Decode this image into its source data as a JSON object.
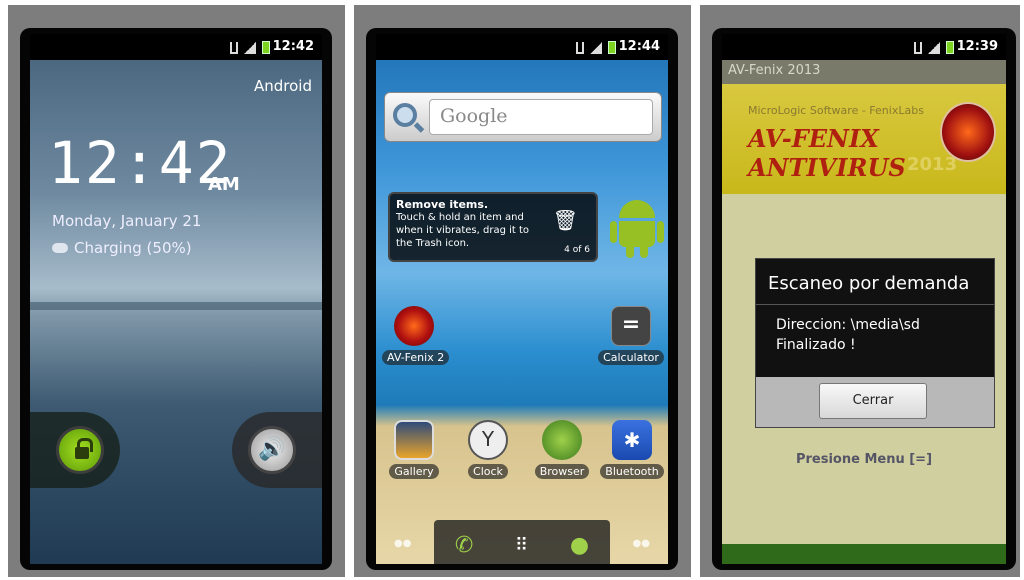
{
  "screen1": {
    "status_time": "12:42",
    "carrier_label": "Android",
    "clock_time": "12:42",
    "clock_ampm": "AM",
    "date": "Monday, January 21",
    "charging": "Charging (50%)"
  },
  "screen2": {
    "status_time": "12:44",
    "search_placeholder": "Google",
    "tip": {
      "title": "Remove items.",
      "body": "Touch & hold an item and when it vibrates, drag it to the Trash icon.",
      "counter": "4 of 6"
    },
    "apps": {
      "avfenix": "AV-Fenix 2",
      "calculator": "Calculator",
      "gallery": "Gallery",
      "clock": "Clock",
      "browser": "Browser",
      "bluetooth": "Bluetooth"
    }
  },
  "screen3": {
    "status_time": "12:39",
    "title": "AV-Fenix 2013",
    "banner_company": "MicroLogic Software - FenixLabs",
    "banner_name": "AV-FENIX ANTIVIRUS",
    "banner_year": "2013",
    "dialog_title": "Escaneo por demanda",
    "dialog_line1": "Direccion: \\media\\sd",
    "dialog_line2": "Finalizado !",
    "dialog_button": "Cerrar",
    "menu_hint": "Presione Menu [=]"
  }
}
